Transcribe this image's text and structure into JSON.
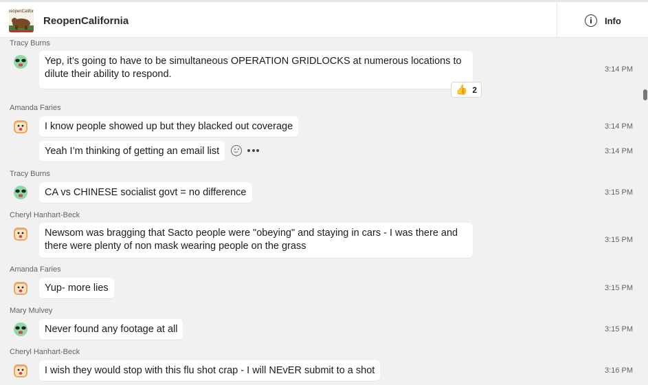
{
  "header": {
    "group_name": "ReopenCalifornia",
    "group_avatar_caption": "reopenCaliforn",
    "info_label": "Info"
  },
  "messages": [
    {
      "sender": "Tracy Burns",
      "avatar": "alien-emoji-avatar",
      "text": "Yep, it’s going to have to be simultaneous OPERATION GRIDLOCKS at numerous locations to dilute their ability to respond.",
      "time": "3:14 PM",
      "reaction": {
        "icon": "thumbs-up-icon",
        "count": "2"
      }
    },
    {
      "sender": "Amanda Faries",
      "avatar": "toast-emoji-avatar",
      "text": "I know people showed up but they blacked out coverage",
      "time": "3:14 PM"
    },
    {
      "text": "Yeah I’m thinking of getting an email list",
      "time": "3:14 PM"
    },
    {
      "sender": "Tracy Burns",
      "avatar": "alien-emoji-avatar",
      "text": "CA vs CHINESE socialist govt = no difference",
      "time": "3:15 PM"
    },
    {
      "sender": "Cheryl Hanhart-Beck",
      "avatar": "toast-emoji-avatar",
      "text": "Newsom was bragging that Sacto people were \"obeying\" and staying in cars - I was there and there were plenty of non mask wearing people on the grass",
      "time": "3:15 PM"
    },
    {
      "sender": "Amanda Faries",
      "avatar": "toast-emoji-avatar",
      "text": "Yup- more lies",
      "time": "3:15 PM"
    },
    {
      "sender": "Mary Mulvey",
      "avatar": "alien-emoji-avatar",
      "text": "Never found any footage at all",
      "time": "3:15 PM"
    },
    {
      "sender": "Cheryl Hanhart-Beck",
      "avatar": "toast-emoji-avatar",
      "text": "I wish they would stop with this flu shot crap - I will NEvER submit to a shot",
      "time": "3:16 PM"
    }
  ]
}
